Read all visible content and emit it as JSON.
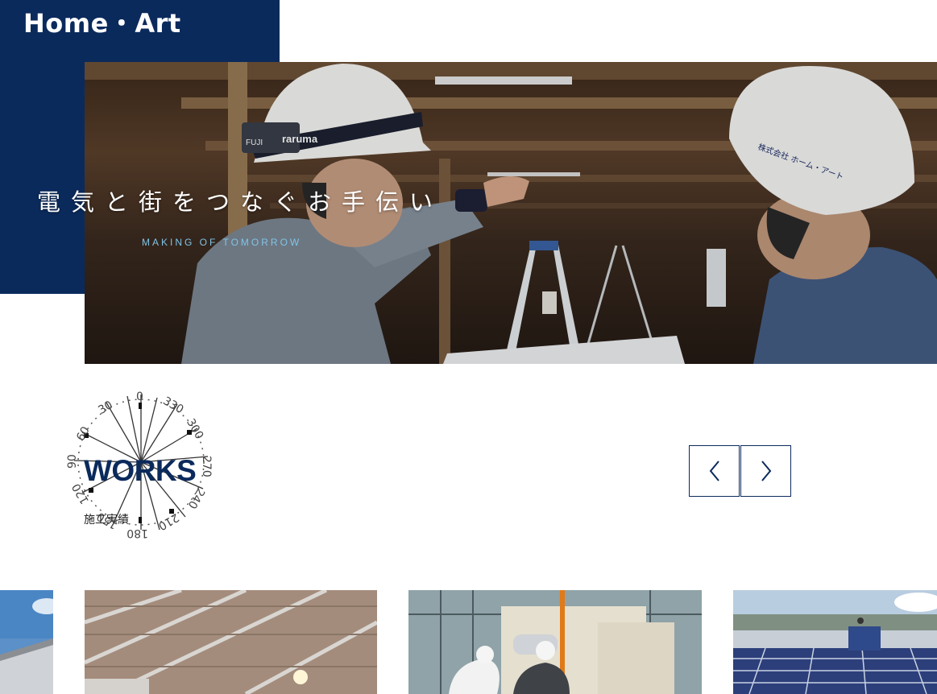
{
  "header": {
    "logo_text": "Home・Art",
    "brand_color": "#0b2a5c"
  },
  "hero": {
    "title": "電気と街をつなぐお手伝い",
    "subtitle": "MAKING OF TOMORROW",
    "helmet_left_strap_text": "raruma",
    "helmet_left_badge": "FUJI",
    "helmet_right_text": "株式会社 ホーム・アート"
  },
  "works": {
    "title": "WORKS",
    "subtitle": "施工実績",
    "dial_labels": [
      "0",
      "330",
      "300",
      "270",
      "240",
      "210",
      "180",
      "150",
      "120",
      "90",
      "60",
      "30"
    ]
  },
  "slider": {
    "prev_icon": "chevron-left-icon",
    "next_icon": "chevron-right-icon"
  },
  "gallery": [
    {
      "name": "works-card-building-sky"
    },
    {
      "name": "works-card-steel-roof"
    },
    {
      "name": "works-card-rooftop-equipment"
    },
    {
      "name": "works-card-solar-panels"
    }
  ]
}
